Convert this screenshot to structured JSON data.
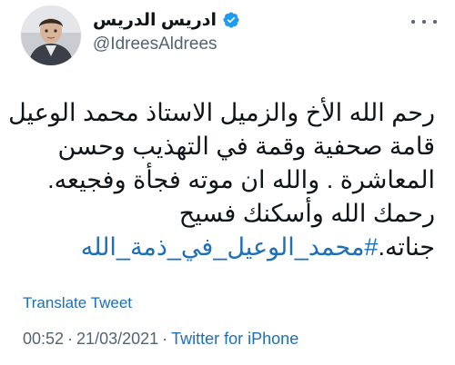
{
  "author": {
    "display_name": "ادريس الدريس",
    "handle": "@IdreesAldrees",
    "verified": true
  },
  "tweet": {
    "lines": [
      "رحم الله الأخ والزميل الاستاذ محمد الوعيل .",
      "قامة صحفية وقمة في التهذيب وحسن",
      "المعاشرة .   والله ان موته فجأة وفجيعه.",
      "رحمك الله وأسكنك فسيح"
    ],
    "last_line_prefix": "جناته.",
    "hashtag": "#محمد_الوعيل_في_ذمة_الله"
  },
  "translate_label": "Translate Tweet",
  "meta": {
    "time": "00:52",
    "separator": "·",
    "date": "21/03/2021",
    "source": "Twitter for iPhone"
  },
  "colors": {
    "text": "#0f1419",
    "secondary": "#536471",
    "link": "#1d6fb8",
    "verified_badge": "#1d9bf0"
  },
  "icons": {
    "verified": "verified-badge-icon",
    "more": "more-options-icon"
  }
}
